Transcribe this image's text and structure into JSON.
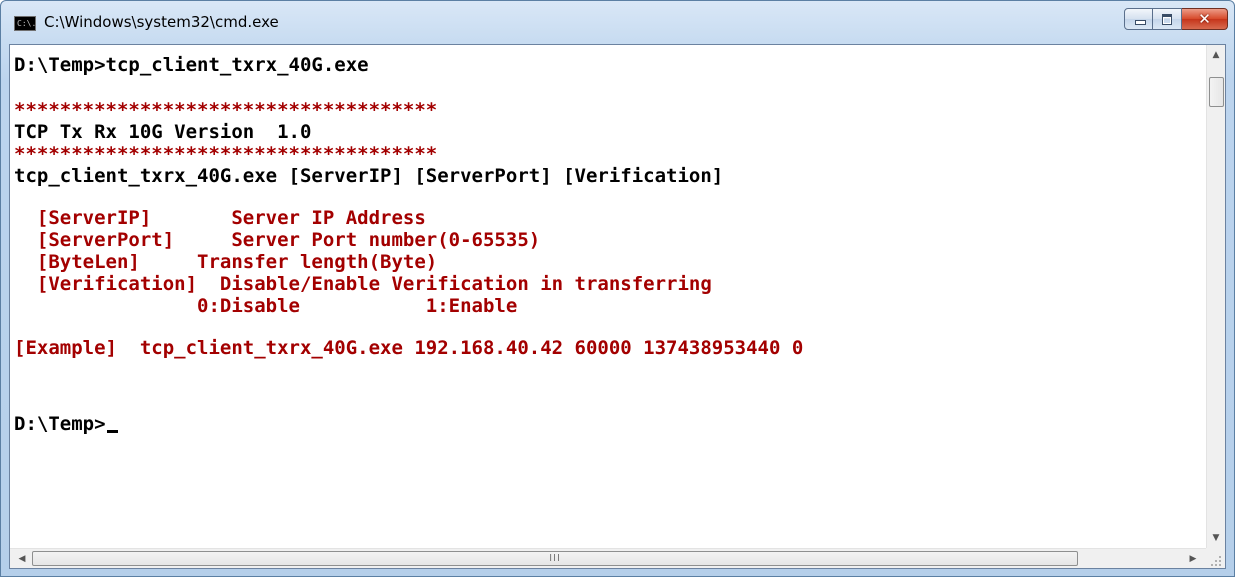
{
  "window": {
    "title": "C:\\Windows\\system32\\cmd.exe",
    "icon_text": "C:\\."
  },
  "caption_buttons": {
    "minimize": "minimize",
    "maximize": "maximize",
    "close": "✕"
  },
  "console": {
    "colors": {
      "default": "#000000",
      "output": "#a30000"
    },
    "lines": [
      {
        "text": "D:\\Temp>tcp_client_txrx_40G.exe",
        "color": "#000000"
      },
      {
        "text": "*************************************",
        "color": "#a30000"
      },
      {
        "text": "TCP Tx Rx 10G Version  1.0",
        "color": "#000000"
      },
      {
        "text": "*************************************",
        "color": "#a30000"
      },
      {
        "text": "tcp_client_txrx_40G.exe [ServerIP] [ServerPort] [Verification]",
        "color": "#000000"
      },
      {
        "text": "  [ServerIP]       Server IP Address",
        "color": "#a30000"
      },
      {
        "text": "  [ServerPort]     Server Port number(0-65535)",
        "color": "#a30000"
      },
      {
        "text": "  [ByteLen]     Transfer length(Byte)",
        "color": "#a30000"
      },
      {
        "text": "  [Verification]  Disable/Enable Verification in transferring",
        "color": "#a30000"
      },
      {
        "text": "                0:Disable           1:Enable",
        "color": "#a30000"
      },
      {
        "text": "[Example]  tcp_client_txrx_40G.exe 192.168.40.42 60000 137438953440 0",
        "color": "#a30000"
      },
      {
        "text": "D:\\Temp>",
        "color": "#000000"
      }
    ]
  },
  "scrollbars": {
    "up_arrow": "▲",
    "down_arrow": "▼",
    "left_arrow": "◀",
    "right_arrow": "▶",
    "grip": "III"
  }
}
